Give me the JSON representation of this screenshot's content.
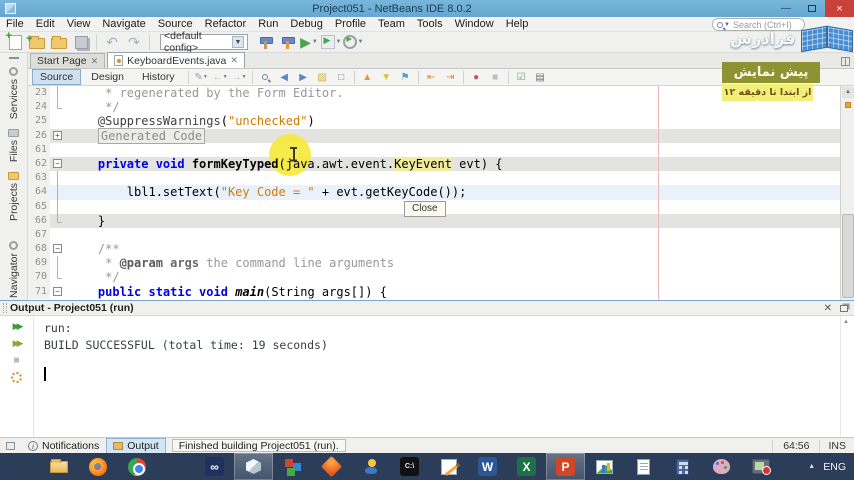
{
  "window": {
    "title": "Project051 - NetBeans IDE 8.0.2"
  },
  "menu": {
    "items": [
      "File",
      "Edit",
      "View",
      "Navigate",
      "Source",
      "Refactor",
      "Run",
      "Debug",
      "Profile",
      "Team",
      "Tools",
      "Window",
      "Help"
    ]
  },
  "toolbar": {
    "config_value": "<default config>",
    "items": [
      {
        "name": "new-file-button",
        "cls": "icnewfile"
      },
      {
        "name": "new-project-button",
        "cls": "icnewproj"
      },
      {
        "name": "open-project-button",
        "cls": "icopenproj"
      },
      {
        "name": "save-all-button",
        "cls": "icsave"
      },
      {
        "sep": true
      },
      {
        "name": "undo-button",
        "glyph": "↶",
        "color": "#9fb2bf"
      },
      {
        "name": "redo-button",
        "glyph": "↷",
        "color": "#9fb2bf"
      },
      {
        "sep": true
      },
      {
        "select": true
      },
      {
        "name": "build-project-button",
        "cls": "ichammer"
      },
      {
        "name": "clean-build-button",
        "cls": "ichammer2"
      },
      {
        "name": "run-project-button",
        "glyph": "▶",
        "color": "#4aa54a",
        "dd": true
      },
      {
        "name": "debug-project-button",
        "cls": "icdebug",
        "dd": true
      },
      {
        "name": "profile-project-button",
        "cls": "icprofile",
        "dd": true
      }
    ]
  },
  "search": {
    "placeholder": "Search (Ctrl+I)"
  },
  "watermark": {
    "brand": "فرادرس"
  },
  "overlay": {
    "preview_label": "پیش نمایش",
    "range_label": "از ابتدا تا دقیقه ۱۲"
  },
  "sidebar": {
    "items": [
      "Services",
      "Files",
      "Projects"
    ],
    "lower_items": [
      "Navigator"
    ]
  },
  "tabs": {
    "items": [
      {
        "label": "Start Page"
      },
      {
        "label": "KeyboardEvents.java"
      }
    ]
  },
  "editor": {
    "views": [
      "Source",
      "Design",
      "History"
    ],
    "close_tooltip": "Close",
    "toolbar_icons": [
      {
        "n": "last-edited-icon",
        "g": "✎",
        "c": "#97a0a8",
        "dd": true
      },
      {
        "n": "back-icon",
        "g": "←",
        "c": "#a8bac8",
        "dd": true
      },
      {
        "n": "forward-icon",
        "g": "→",
        "c": "#a8bac8",
        "dd": true
      },
      {
        "sep": true
      },
      {
        "n": "find-icon",
        "mag": true
      },
      {
        "n": "find-previous-occurrence-icon",
        "g": "◀",
        "c": "#5b87c2"
      },
      {
        "n": "find-next-occurrence-icon",
        "g": "▶",
        "c": "#5b87c2"
      },
      {
        "n": "toggle-highlight-icon",
        "g": "▧",
        "c": "#c9b83c"
      },
      {
        "n": "select-in-projects-icon",
        "g": "□",
        "c": "#7a8a99"
      },
      {
        "sep": true
      },
      {
        "n": "previous-bookmark-icon",
        "g": "▲",
        "c": "#e09a38"
      },
      {
        "n": "next-bookmark-icon",
        "g": "▼",
        "c": "#d9c23a"
      },
      {
        "n": "toggle-bookmark-icon",
        "g": "⚑",
        "c": "#4fa3c8"
      },
      {
        "sep": true
      },
      {
        "n": "shift-left-icon",
        "g": "⇤",
        "c": "#d98a3a"
      },
      {
        "n": "shift-right-icon",
        "g": "⇥",
        "c": "#d98a3a"
      },
      {
        "sep": true
      },
      {
        "n": "start-macro-icon",
        "g": "●",
        "c": "#cc5555"
      },
      {
        "n": "stop-macro-icon",
        "g": "■",
        "c": "#b9bdc1"
      },
      {
        "sep": true
      },
      {
        "n": "comment-icon",
        "g": "☑",
        "c": "#69a45c"
      },
      {
        "n": "uncomment-icon",
        "g": "▤",
        "c": "#6b7077"
      }
    ],
    "lines": [
      {
        "n": "23",
        "fold": "line",
        "segs": [
          [
            "     * regenerated by the Form Editor.",
            "com"
          ]
        ]
      },
      {
        "n": "24",
        "fold": "close",
        "segs": [
          [
            "     */",
            "com"
          ]
        ]
      },
      {
        "n": "25",
        "fold": "",
        "segs": [
          [
            "    ",
            "pl"
          ],
          [
            "@SuppressWarnings",
            "ann"
          ],
          [
            "(",
            "pl"
          ],
          [
            "\"unchecked\"",
            "str"
          ],
          [
            ")",
            "pl"
          ]
        ]
      },
      {
        "n": "26",
        "fold": "plus",
        "bg": "row",
        "segs": [
          [
            "    ",
            "pl"
          ],
          [
            "Generated Code",
            "fold"
          ]
        ]
      },
      {
        "n": "61",
        "fold": "",
        "segs": []
      },
      {
        "n": "62",
        "fold": "minus",
        "bg": "row",
        "segs": [
          [
            "    ",
            "pl"
          ],
          [
            "private void ",
            "kw"
          ],
          [
            "formKeyTyped",
            "bold"
          ],
          [
            "(java.awt.event.",
            "pl"
          ],
          [
            "KeyEvent",
            "occ"
          ],
          [
            " evt) {",
            "pl"
          ]
        ]
      },
      {
        "n": "63",
        "fold": "line",
        "segs": []
      },
      {
        "n": "64",
        "fold": "line",
        "bg": "caret",
        "segs": [
          [
            "        lbl1.setText(",
            "pl"
          ],
          [
            "\"Key Code = \"",
            "str"
          ],
          [
            " + evt.getKeyCode());",
            "pl"
          ]
        ]
      },
      {
        "n": "65",
        "fold": "line",
        "segs": []
      },
      {
        "n": "66",
        "fold": "close",
        "bg": "row",
        "segs": [
          [
            "    }",
            "pl"
          ]
        ]
      },
      {
        "n": "67",
        "fold": "",
        "segs": []
      },
      {
        "n": "68",
        "fold": "minus",
        "segs": [
          [
            "    /**",
            "com"
          ]
        ]
      },
      {
        "n": "69",
        "fold": "line",
        "segs": [
          [
            "     * ",
            "com"
          ],
          [
            "@param",
            "jdt"
          ],
          [
            " ",
            "com"
          ],
          [
            "args",
            "jdb"
          ],
          [
            " the command line arguments",
            "com"
          ]
        ]
      },
      {
        "n": "70",
        "fold": "close",
        "segs": [
          [
            "     */",
            "com"
          ]
        ]
      },
      {
        "n": "71",
        "fold": "minus",
        "segs": [
          [
            "    ",
            "pl"
          ],
          [
            "public static void ",
            "kw"
          ],
          [
            "main",
            "mainm"
          ],
          [
            "(String args[]) {",
            "pl"
          ]
        ]
      }
    ]
  },
  "output": {
    "title": "Output - Project051 (run)",
    "lines": [
      "run:",
      "BUILD SUCCESSFUL (total time: 19 seconds)"
    ]
  },
  "statusbar": {
    "notifications_label": "Notifications",
    "output_label": "Output",
    "status_text": "Finished building Project051 (run).",
    "caret_position": "64:56",
    "insert_mode": "INS"
  },
  "taskbar": {
    "lang": "ENG",
    "items": [
      {
        "name": "start-button",
        "cls": "win"
      },
      {
        "name": "file-explorer-icon",
        "cls": "folder"
      },
      {
        "name": "firefox-icon",
        "cls": "firefox"
      },
      {
        "name": "chrome-icon",
        "cls": "chrome"
      },
      {
        "name": "office-blocks-icon",
        "cls": "blocks"
      },
      {
        "name": "visual-studio-icon",
        "cls": "glyph",
        "glyph": "∞",
        "bg": "#21315e",
        "fg": "#ffffff"
      },
      {
        "name": "netbeans-icon",
        "cls": "cube",
        "active": true
      },
      {
        "name": "colored-cubes-icon",
        "cls": "cubes3"
      },
      {
        "name": "matlab-icon",
        "cls": "matlab"
      },
      {
        "name": "utility-icon",
        "cls": "spark"
      },
      {
        "name": "command-prompt-icon",
        "cls": "glyph",
        "glyph": "C:\\",
        "bg": "#111111",
        "fg": "#eeeeee"
      },
      {
        "name": "pencil-editor-icon",
        "cls": "pencil"
      },
      {
        "name": "word-icon",
        "cls": "glyph",
        "glyph": "W",
        "bg": "#2b5797",
        "fg": "#ffffff"
      },
      {
        "name": "excel-icon",
        "cls": "glyph",
        "glyph": "X",
        "bg": "#1e7145",
        "fg": "#ffffff"
      },
      {
        "name": "powerpoint-icon",
        "cls": "glyph",
        "glyph": "P",
        "bg": "#d04727",
        "fg": "#ffffff",
        "active": true
      },
      {
        "name": "image-chart-icon",
        "cls": "chartpic"
      },
      {
        "name": "notepad-icon",
        "cls": "notepad"
      },
      {
        "name": "calculator-icon",
        "cls": "calc"
      },
      {
        "name": "paint-icon",
        "cls": "paint"
      },
      {
        "name": "screen-recorder-icon",
        "cls": "capture"
      }
    ]
  }
}
